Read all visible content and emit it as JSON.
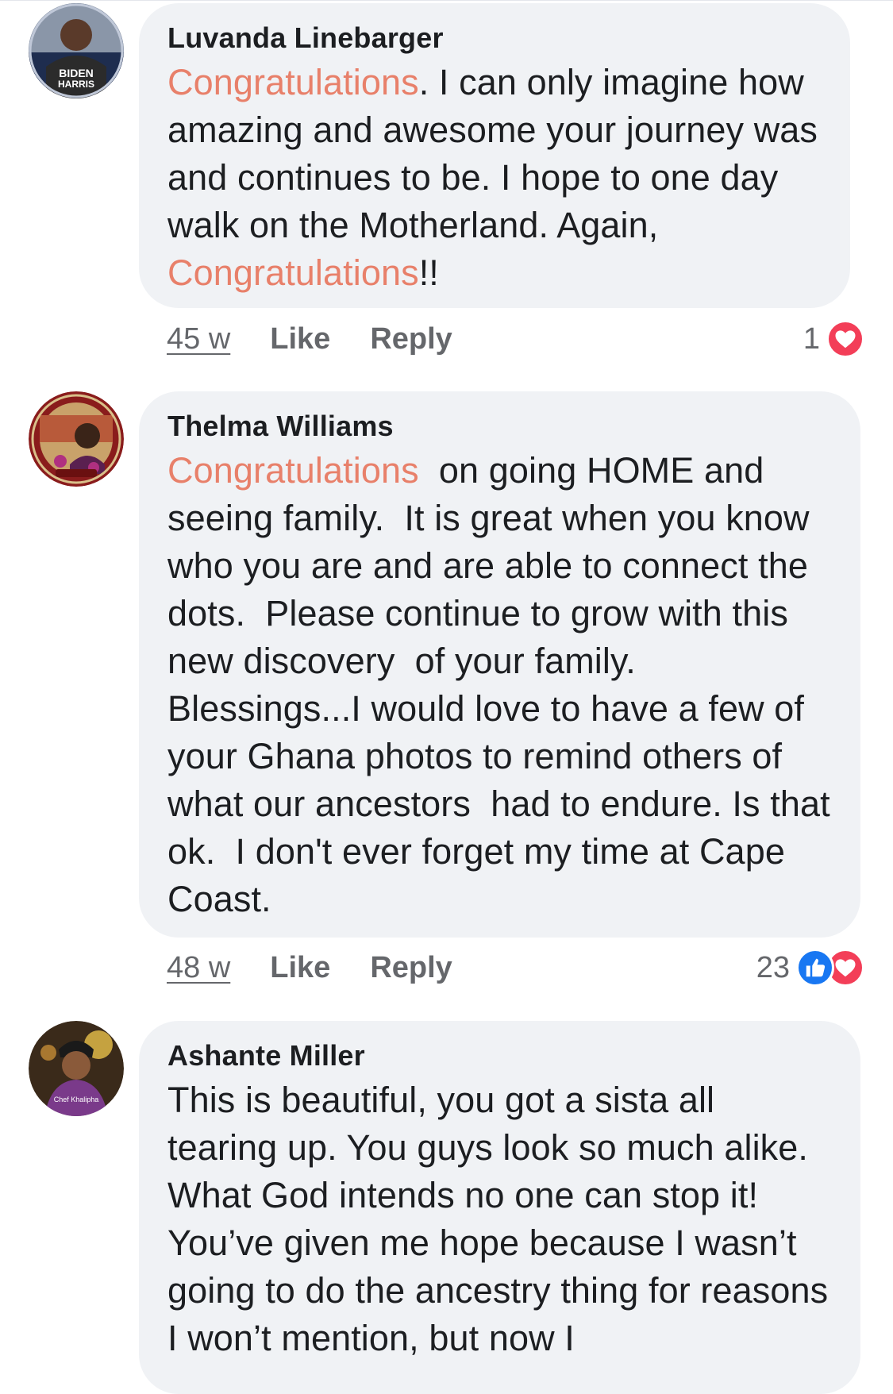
{
  "comments": [
    {
      "author": "Luvanda Linebarger",
      "avatar_text_1": "BIDEN",
      "avatar_text_2": "HARRIS",
      "segments": [
        {
          "text": "Congratulations",
          "highlight": true
        },
        {
          "text": ". I can only imagine how amazing and awesome your journey was and continues to be. I hope to one day walk on the Motherland. Again, ",
          "highlight": false
        },
        {
          "text": "Congratulations",
          "highlight": true
        },
        {
          "text": "!!",
          "highlight": false
        }
      ],
      "time": "45 w",
      "like_label": "Like",
      "reply_label": "Reply",
      "reaction_count": "1",
      "reactions": [
        "heart-icon"
      ]
    },
    {
      "author": "Thelma Williams",
      "segments": [
        {
          "text": "Congratulations",
          "highlight": true
        },
        {
          "text": "  on going HOME and seeing family.  It is great when you know who you are and are able to connect the dots.  Please continue to grow with this new discovery  of your family. Blessings...I would love to have a few of your Ghana photos to remind others of what our ancestors  had to endure. Is that ok.  I don't ever forget my time at Cape Coast.",
          "highlight": false
        }
      ],
      "time": "48 w",
      "like_label": "Like",
      "reply_label": "Reply",
      "reaction_count": "23",
      "reactions": [
        "thumbs-up-icon",
        "heart-icon"
      ]
    },
    {
      "author": "Ashante Miller",
      "avatar_text_1": "Chef Khalipha",
      "segments": [
        {
          "text": "This is beautiful, you got a sista all tearing up. You guys look so much alike. What God intends no one can stop it! You’ve given me hope because I wasn’t going to do the ancestry thing for reasons I won’t mention, but now I",
          "highlight": false
        }
      ]
    }
  ],
  "colors": {
    "highlight": "#e8806a",
    "bubble": "#f0f2f5",
    "meta": "#65676b",
    "like_blue": "#1877f2",
    "love_red": "#f33e58"
  }
}
